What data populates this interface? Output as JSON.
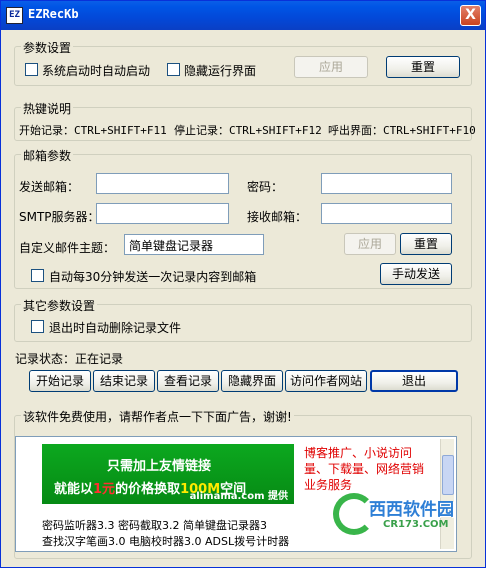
{
  "window": {
    "title": "EZRecKb",
    "icon_text": "EZ",
    "close_label": "X"
  },
  "params": {
    "legend": "参数设置",
    "autostart_label": "系统启动时自动启动",
    "hide_ui_label": "隐藏运行界面",
    "apply_label": "应用",
    "reset_label": "重置"
  },
  "hotkeys": {
    "legend": "热键说明",
    "start": "开始记录：CTRL+SHIFT+F11",
    "stop": "停止记录：CTRL+SHIFT+F12",
    "show": "呼出界面：CTRL+SHIFT+F10"
  },
  "mail": {
    "legend": "邮箱参数",
    "send_label": "发送邮箱：",
    "password_label": "密码：",
    "smtp_label": "SMTP服务器：",
    "recv_label": "接收邮箱：",
    "subject_label": "自定义邮件主题：",
    "subject_value": "简单键盘记录器",
    "send_value": "",
    "password_value": "",
    "smtp_value": "",
    "recv_value": "",
    "apply_label": "应用",
    "reset_label": "重置",
    "auto_send_label": "自动每30分钟发送一次记录内容到邮箱",
    "manual_send_label": "手动发送"
  },
  "other": {
    "legend": "其它参数设置",
    "delete_on_exit_label": "退出时自动删除记录文件"
  },
  "status": {
    "text": "记录状态：正在记录"
  },
  "actions": {
    "start": "开始记录",
    "stop": "结束记录",
    "view": "查看记录",
    "hide": "隐藏界面",
    "visit": "访问作者网站",
    "exit": "退出"
  },
  "ad": {
    "legend": "该软件免费使用，请帮作者点一下下面广告，谢谢!",
    "banner_line1": "只需加上友情链接",
    "banner_line2_a": "就能以",
    "banner_line2_price": "1元",
    "banner_line2_b": "的价格换取",
    "banner_line2_size": "100M",
    "banner_line2_c": "空间",
    "banner_brand": "alimama.com 提供",
    "red_text": "博客推广、小说访问量、下载量、网络营销业务服务",
    "line1": "密码监听器3.3  密码截取3.2  简单键盘记录器3",
    "line2": "查找汉字笔画3.0  电脑校时器3.0  ADSL拨号计时器"
  },
  "watermark": {
    "text": "西西软件园",
    "sub": "CR173.COM"
  }
}
